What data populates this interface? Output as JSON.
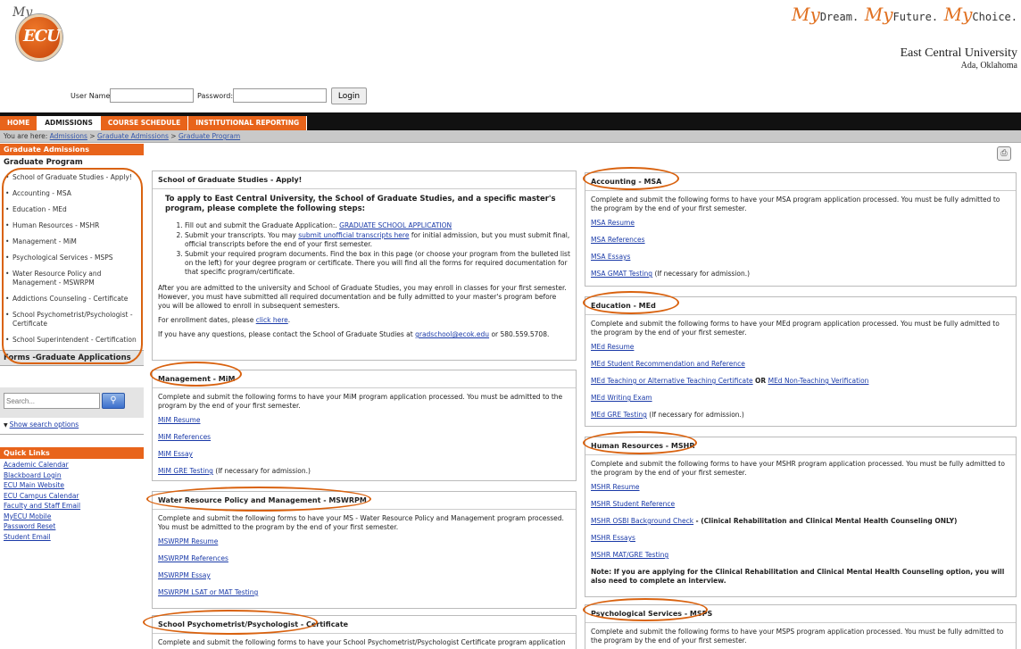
{
  "header": {
    "logo_my": "My",
    "logo_text": "ECU",
    "tagline": [
      {
        "my": "My",
        "word": "Dream."
      },
      {
        "my": "My",
        "word": "Future."
      },
      {
        "my": "My",
        "word": "Choice."
      }
    ],
    "university": "East Central University",
    "location": "Ada, Oklahoma"
  },
  "login": {
    "username_label": "User Name:",
    "username_value": "",
    "password_label": "Password:",
    "password_value": "",
    "button": "Login"
  },
  "nav": {
    "tabs": [
      "HOME",
      "ADMISSIONS",
      "COURSE SCHEDULE",
      "INSTITUTIONAL REPORTING"
    ],
    "active": "ADMISSIONS"
  },
  "breadcrumb": {
    "prefix": "You are here:",
    "items": [
      "Admissions",
      "Graduate Admissions",
      "Graduate Program"
    ],
    "separator": ">"
  },
  "sidebar": {
    "section_header": "Graduate Admissions",
    "title": "Graduate Program",
    "items": [
      "School of Graduate Studies - Apply!",
      "Accounting - MSA",
      "Education - MEd",
      "Human Resources - MSHR",
      "Management - MiM",
      "Psychological Services - MSPS",
      "Water Resource Policy and Management - MSWRPM",
      "Addictions Counseling - Certificate",
      "School Psychometrist/Psychologist - Certificate",
      "School Superintendent - Certification"
    ],
    "forms_title": "Forms -Graduate Applications",
    "search_placeholder": "Search...",
    "search_options": "Show search options",
    "quick_links_header": "Quick Links",
    "quick_links": [
      "Academic Calendar",
      "Blackboard Login",
      "ECU Main Website",
      "ECU Campus Calendar",
      "Faculty and Staff Email",
      "MyECU Mobile",
      "Password Reset",
      "Student Email"
    ]
  },
  "apply_box": {
    "title": "School of Graduate Studies - Apply!",
    "intro": "To apply to East Central University, the School of Graduate Studies, and a specific master's program, please complete the following steps:",
    "step1_text": "Fill out and submit the Graduate Application:.",
    "step1_link": "GRADUATE SCHOOL APPLICATION",
    "step2_text_a": "Submit your transcripts.  You may",
    "step2_link": "submit unofficial transcripts here",
    "step2_text_b": "for initial admission, but you must submit final, official transcripts before the end of your first semester.",
    "step3_text": "Submit your required program documents.  Find the box in this page (or choose your program from the bulleted list on the left) for your degree program or certificate.  There you will find all the forms for required documentation for that specific program/certificate.",
    "para1": "After you are admitted to the university and School of Graduate Studies, you may enroll in classes for your first semester.  However, you must have submitted all required documentation and be fully admitted to your master's program before you will be allowed to enroll in subsequent semesters.",
    "enroll_text": "For enrollment dates, please",
    "enroll_link": "click here",
    "contact_text": "If you have any questions, please contact the School of Graduate Studies at",
    "contact_email": "gradschool@ecok.edu",
    "contact_phone": "or 580.559.5708."
  },
  "mim_box": {
    "title": "Management - MiM",
    "desc": "Complete and submit the following forms to have your MiM program application processed.  You must be admitted to the program by the end of your first semester.",
    "links": [
      "MiM Resume",
      "MiM References",
      "MiM Essay",
      "MiM GRE Testing"
    ],
    "gre_note": "(If necessary for admission.)"
  },
  "mswrpm_box": {
    "title": "Water Resource Policy and Management - MSWRPM",
    "desc": "Complete and submit the following forms to have your MS - Water Resource Policy and Management program processed.  You must be admitted to the program by the end of your first semester.",
    "links": [
      "MSWRPM Resume",
      "MSWRPM References",
      "MSWRPM Essay",
      "MSWRPM LSAT or MAT Testing"
    ]
  },
  "psych_cert_box": {
    "title": "School Psychometrist/Psychologist - Certificate",
    "desc": "Complete and submit the following forms to have your School Psychometrist/Psychologist Certificate program application"
  },
  "msa_box": {
    "title": "Accounting - MSA",
    "desc": "Complete and submit the following forms to have your MSA program application processed.  You must be fully admitted to the program by the end of your first semester.",
    "links": [
      "MSA Resume",
      "MSA References",
      "MSA Essays",
      "MSA GMAT Testing"
    ],
    "gmat_note": "(If necessary for admission.)"
  },
  "med_box": {
    "title": "Education - MEd",
    "desc": "Complete and submit the following forms to have your MEd program application processed.  You must be fully admitted to the program by the end of your first semester.",
    "links": [
      "MEd Resume",
      "MEd Student Recommendation and Reference",
      "MEd Teaching or Alternative Teaching Certificate",
      "MEd Non-Teaching Verification",
      "MEd Writing Exam",
      "MEd GRE Testing"
    ],
    "or_text": "OR",
    "gre_note": "(If necessary for admission.)"
  },
  "mshr_box": {
    "title": "Human Resources - MSHR",
    "desc": "Complete and submit the following forms to have your MSHR program application processed.  You must be fully admitted to the program by the end of your first semester.",
    "links": [
      "MSHR Resume",
      "MSHR Student Reference",
      "MSHR OSBI Background Check",
      "MSHR Essays",
      "MSHR MAT/GRE Testing"
    ],
    "osbi_note": "- (Clinical Rehabilitation and Clinical Mental Health Counseling ONLY)",
    "note": "Note: If you are applying for the Clinical Rehabilitation and Clinical Mental Health Counseling option, you will also need to complete an interview."
  },
  "msps_box": {
    "title": "Psychological Services - MSPS",
    "desc": "Complete and submit the following forms to have your MSPS program application processed.  You must be fully admitted to the program by the end of your first semester."
  },
  "colors": {
    "accent_orange": "#e8641b",
    "annotation_orange": "#d9620f",
    "link_blue": "#1a3aa8",
    "nav_black": "#111111"
  },
  "icons": {
    "print": "printer-icon",
    "search": "search-icon"
  }
}
